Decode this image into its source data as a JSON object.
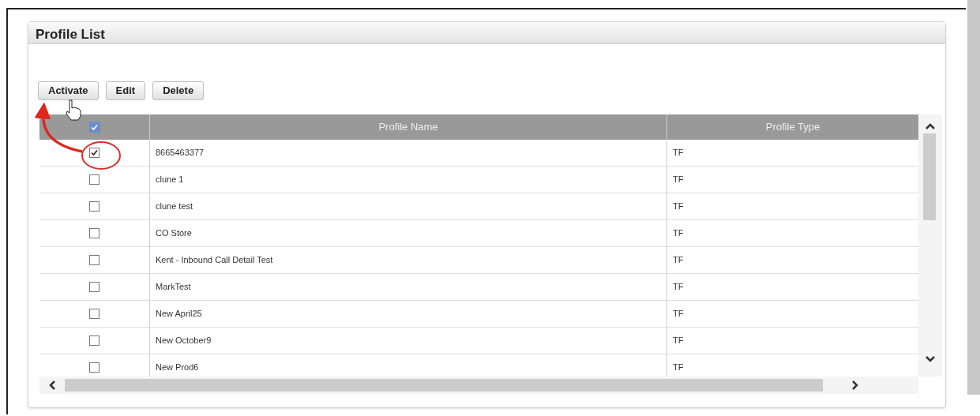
{
  "panel": {
    "title": "Profile List"
  },
  "buttons": [
    {
      "label": "Activate"
    },
    {
      "label": "Edit"
    },
    {
      "label": "Delete"
    }
  ],
  "table": {
    "select_all": {
      "checked": true
    },
    "columns": [
      "Profile Name",
      "Profile Type"
    ],
    "rows": [
      {
        "checked": true,
        "name": "8665463377",
        "type": "TF"
      },
      {
        "checked": false,
        "name": "clune 1",
        "type": "TF"
      },
      {
        "checked": false,
        "name": "clune test",
        "type": "TF"
      },
      {
        "checked": false,
        "name": "CO Store",
        "type": "TF"
      },
      {
        "checked": false,
        "name": "Kent - Inbound Call Detail Test",
        "type": "TF"
      },
      {
        "checked": false,
        "name": "MarkTest",
        "type": "TF"
      },
      {
        "checked": false,
        "name": "New April25",
        "type": "TF"
      },
      {
        "checked": false,
        "name": "New October9",
        "type": "TF"
      },
      {
        "checked": false,
        "name": "New Prod6",
        "type": "TF"
      }
    ]
  }
}
